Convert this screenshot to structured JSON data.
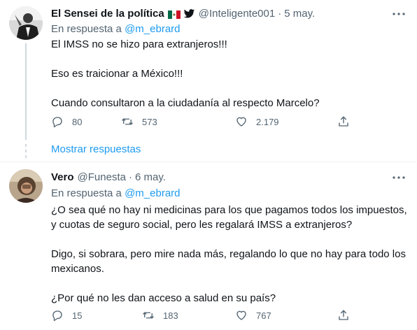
{
  "tweet1": {
    "name": "El Sensei de la política",
    "handle": "@Inteligente001",
    "separator": "·",
    "date": "5 may.",
    "reply_prefix": "En respuesta a",
    "reply_to": "@m_ebrard",
    "paragraphs": [
      "El IMSS no se hizo para extranjeros!!!",
      "Eso es traicionar a México!!!",
      "Cuando consultaron a la ciudadanía al respecto Marcelo?"
    ],
    "replies": "80",
    "retweets": "573",
    "likes": "2.179"
  },
  "show_replies_label": "Mostrar respuestas",
  "tweet2": {
    "name": "Vero",
    "handle": "@Funesta",
    "separator": "·",
    "date": "6 may.",
    "reply_prefix": "En respuesta a",
    "reply_to": "@m_ebrard",
    "paragraphs": [
      "¿O sea qué no hay ni medicinas para los que pagamos todos los impuestos, y cuotas de seguro social, pero les regalará IMSS a extranjeros?",
      "Digo, si sobrara, pero mire nada más, regalando lo que no hay para todo los mexicanos.",
      "¿Por qué no les dan acceso a salud en su país?"
    ],
    "replies": "15",
    "retweets": "183",
    "likes": "767"
  },
  "colors": {
    "link": "#1d9bf0",
    "muted": "#536471",
    "text": "#0f1419",
    "line": "#cfd9de"
  },
  "icons": [
    "reply-icon",
    "retweet-icon",
    "like-icon",
    "share-icon",
    "more-icon",
    "mexico-flag-icon",
    "twitter-bird-icon"
  ]
}
